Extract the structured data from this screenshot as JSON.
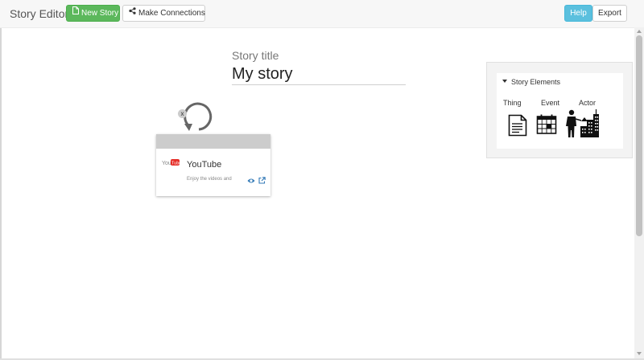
{
  "app": {
    "title": "Story Editor"
  },
  "toolbar": {
    "new_story_label": "New Story",
    "make_connections_label": "Make Connections",
    "help_label": "Help",
    "export_label": "Export"
  },
  "story": {
    "title_label": "Story title",
    "title_value": "My story"
  },
  "card": {
    "title": "YouTube",
    "description": "Enjoy the videos and",
    "close_label": "x"
  },
  "panel": {
    "title": "Story Elements",
    "items": [
      {
        "label": "Thing",
        "icon": "document-icon"
      },
      {
        "label": "Event",
        "icon": "calendar-icon"
      },
      {
        "label": "Actor",
        "icon": "person-city-icon"
      }
    ]
  },
  "colors": {
    "primary_green": "#5cb85c",
    "info_blue": "#5bc0de",
    "card_header": "#cccccc",
    "panel_bg": "#f3f3f3"
  }
}
